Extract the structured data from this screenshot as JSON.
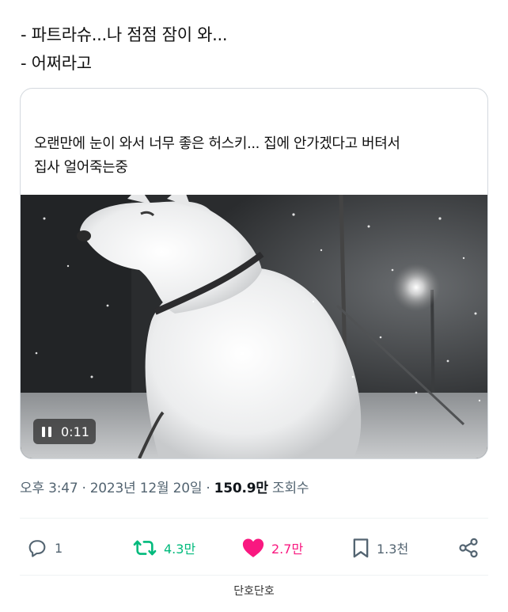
{
  "dialog_lines": [
    "- 파트라슈...나 점점 잠이 와...",
    "- 어쩌라고"
  ],
  "tweet": {
    "text_line1": "오랜만에 눈이 와서 너무 좋은 허스키... 집에 안가겠다고 버텨서",
    "text_line2": "집사 얼어죽는중",
    "media": {
      "video_time": "0:11",
      "description_icon": "pause-icon"
    },
    "time": "오후 3:47",
    "date": "2023년 12월 20일",
    "dot": "·",
    "views_number": "150.9만",
    "views_label": "조회수",
    "actions": {
      "reply_count": "1",
      "retweet_count": "4.3만",
      "like_count": "2.7만",
      "bookmark_count": "1.3천"
    }
  },
  "footer": "단호단호",
  "colors": {
    "retweet": "#00ba7c",
    "like": "#f91880",
    "secondary": "#536471",
    "border": "#d4d9de"
  }
}
